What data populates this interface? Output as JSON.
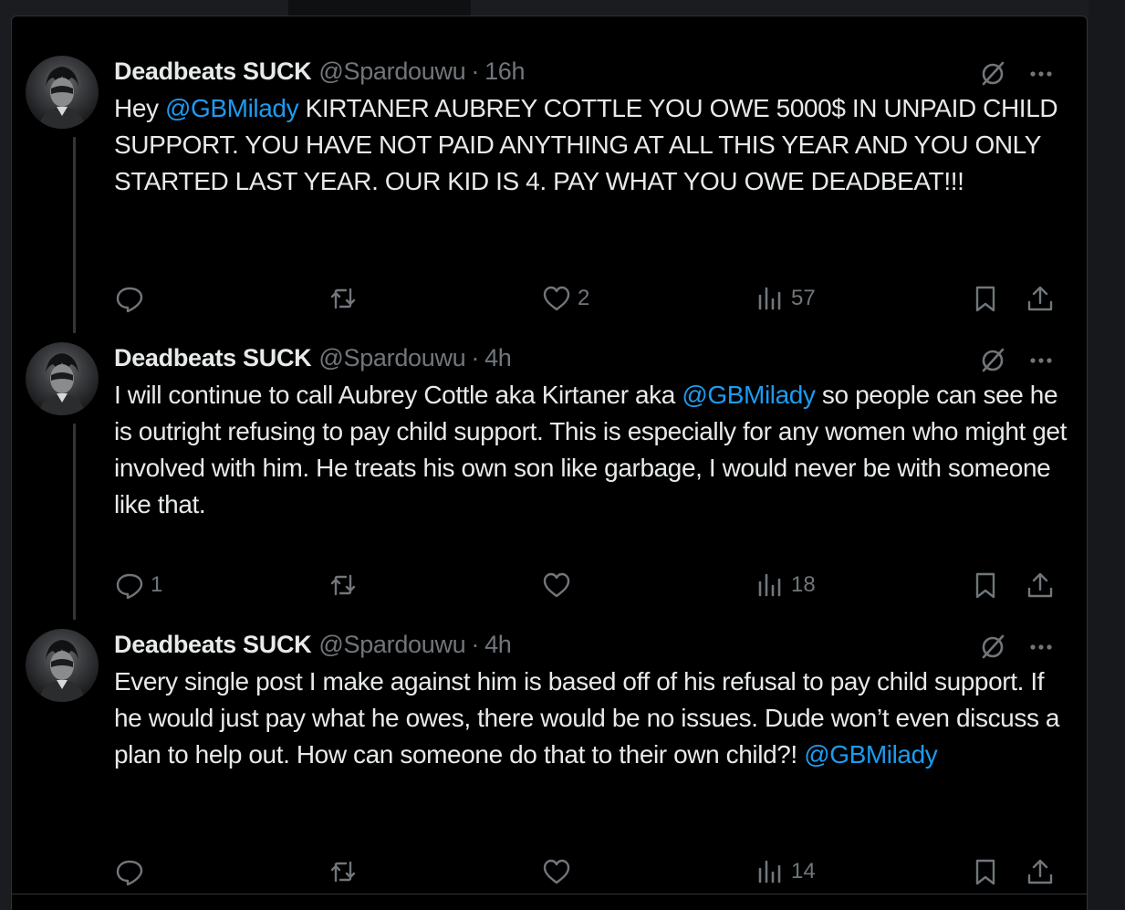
{
  "tweets": [
    {
      "name": "Deadbeats SUCK",
      "handle": "@Spardouwu",
      "separator": "·",
      "time": "16h",
      "text_before": "Hey ",
      "mention": "@GBMilady",
      "text_after": "  KIRTANER AUBREY COTTLE YOU OWE 5000$ IN UNPAID CHILD SUPPORT. YOU HAVE NOT PAID ANYTHING AT ALL THIS YEAR AND YOU ONLY STARTED LAST YEAR. OUR KID IS 4. PAY WHAT YOU OWE DEADBEAT!!!",
      "replies": "",
      "retweets": "",
      "likes": "2",
      "views": "57"
    },
    {
      "name": "Deadbeats SUCK",
      "handle": "@Spardouwu",
      "separator": "·",
      "time": "4h",
      "text_before": "I will continue to call Aubrey Cottle aka Kirtaner aka ",
      "mention": "@GBMilady",
      "text_after": " so people can see he is outright refusing to pay child support. This is especially for any women who might get involved with him. He treats his own son like garbage, I would never be with someone like that.",
      "replies": "1",
      "retweets": "",
      "likes": "",
      "views": "18"
    },
    {
      "name": "Deadbeats SUCK",
      "handle": "@Spardouwu",
      "separator": "·",
      "time": "4h",
      "text_before": "Every single post I make against him is based off of his refusal to pay child support. If he would just pay what he owes, there would be no issues. Dude won’t even discuss a plan to help out. How can someone do that to their own child?! ",
      "mention": "@GBMilady",
      "text_after": "",
      "replies": "",
      "retweets": "",
      "likes": "",
      "views": "14"
    }
  ],
  "icons": {
    "reply": "reply-icon",
    "retweet": "retweet-icon",
    "like": "heart-icon",
    "views": "views-icon",
    "bookmark": "bookmark-icon",
    "share": "share-icon",
    "grok": "grok-icon",
    "more": "more-icon"
  },
  "colors": {
    "background": "#000000",
    "text": "#e7e9ea",
    "muted": "#71767b",
    "mention": "#1d9bf0",
    "thread_line": "#333639"
  }
}
